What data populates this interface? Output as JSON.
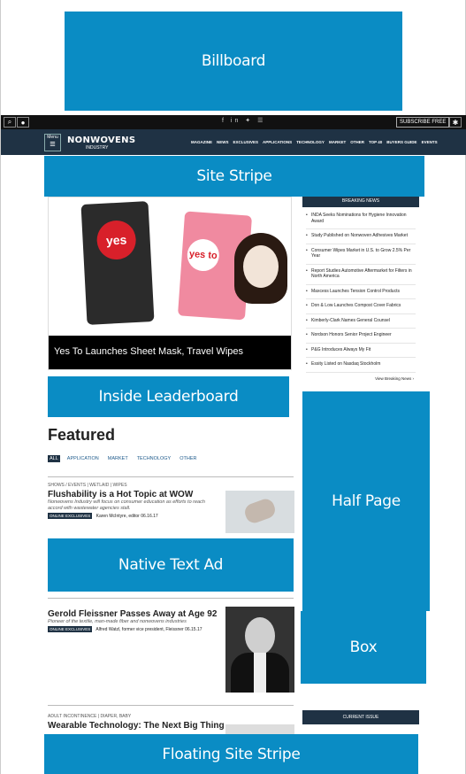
{
  "ads": {
    "billboard": "Billboard",
    "site_stripe": "Site Stripe",
    "inside_leaderboard": "Inside Leaderboard",
    "half_page": "Half Page",
    "native_text_ad": "Native Text Ad",
    "box": "Box",
    "floating_site_stripe": "Floating Site Stripe"
  },
  "topbar": {
    "social_icons": "f in ✦ ☰",
    "subscribe_label": "SUBSCRIBE FREE"
  },
  "nav": {
    "menu_label": "Menu",
    "logo": "NONWOVENS",
    "logo_sub": "INDUSTRY",
    "links": [
      "MAGAZINE",
      "NEWS",
      "EXCLUSIVES",
      "APPLICATIONS",
      "TECHNOLOGY",
      "MARKET",
      "OTHER",
      "TOP 40",
      "BUYERS GUIDE",
      "EVENTS"
    ]
  },
  "hero": {
    "caption": "Yes To Launches Sheet Mask, Travel Wipes",
    "pack1_label": "yes",
    "pack2_label": "yes to"
  },
  "breaking_news": {
    "heading": "BREAKING NEWS",
    "items": [
      "INDA Seeks Nominations for Hygiene Innovation Award",
      "Study Published on Nonwoven Adhesives Market",
      "Consumer Wipes Market in U.S. to Grow 2.5% Per Year",
      "Report Studies Automotive Aftermarket for Filters in North America",
      "Maxcess Launches Tension Control Products",
      "Don & Low Launches Compost Cover Fabrics",
      "Kimberly-Clark Names General Counsel",
      "Nordson Honors Senior Project Engineer",
      "P&G Introduces Always My Fit",
      "Essity Listed on Nasdaq Stockholm"
    ],
    "view_all": "View Breaking News ›"
  },
  "featured": {
    "title": "Featured",
    "tabs": [
      "ALL",
      "APPLICATION",
      "MARKET",
      "TECHNOLOGY",
      "OTHER"
    ]
  },
  "articles": [
    {
      "category": "SHOWS / EVENTS | WETLAID | WIPES",
      "title": "Flushability is a Hot Topic at WOW",
      "description": "Nonwovens Industry will focus on consumer education as efforts to reach accord with wastewater agencies stall.",
      "badge": "ONLINE EXCLUSIVES",
      "author": "Karen McIntyre, editor",
      "date": "06.16.17"
    },
    {
      "category": "",
      "title": "Gerold Fleissner Passes Away at Age 92",
      "description": "Pioneer of the textile, man-made fiber and nonwovens industries",
      "badge": "ONLINE EXCLUSIVES",
      "author": "Alfred Watzl, former vice president, Fleissner",
      "date": "06.15.17"
    },
    {
      "category": "ADULT INCONTINENCE | DIAPER, BABY",
      "title": "Wearable Technology: The Next Big Thing"
    }
  ],
  "current_issue": "CURRENT ISSUE"
}
